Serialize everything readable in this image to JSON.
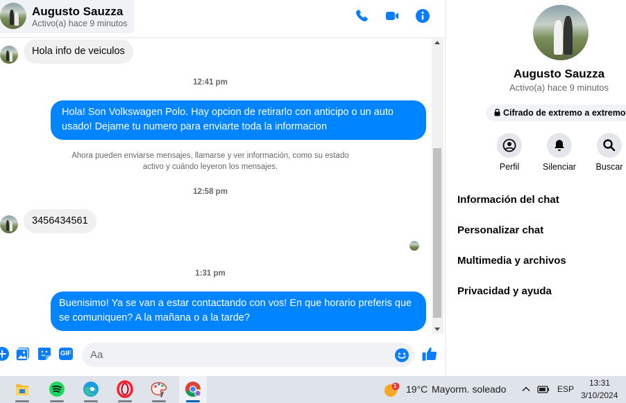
{
  "contact": {
    "name": "Augusto Sauzza",
    "status": "Activo(a) hace 9 minutos"
  },
  "header": {
    "icons": [
      "phone-icon",
      "video-call-icon",
      "info-icon"
    ]
  },
  "messages": [
    {
      "type": "incoming",
      "text": "Hola info de veiculos"
    },
    {
      "type": "time",
      "text": "12:41 pm"
    },
    {
      "type": "outgoing",
      "lines": [
        "Hola! Son Volkswagen Polo. Hay opcion de retirarlo con anticipo o un auto",
        "usado! Dejame tu numero para enviarte toda la informacion"
      ]
    },
    {
      "type": "system",
      "lines": [
        "Ahora pueden enviarse mensajes, llamarse y ver información, como su estado",
        "activo y cuándo leyeron los mensajes."
      ]
    },
    {
      "type": "time",
      "text": "12:58 pm"
    },
    {
      "type": "incoming",
      "text": "3456434561"
    },
    {
      "type": "time",
      "text": "1:31 pm"
    },
    {
      "type": "outgoing",
      "lines": [
        "Buenisimo! Ya se van a estar contactando con vos! En que horario preferis que",
        "se comuniquen? A la mañana o a la tarde?"
      ]
    }
  ],
  "composer": {
    "placeholder": "Aa",
    "value": "",
    "gif_label": "GIF",
    "icons": [
      "plus-icon",
      "image-icon",
      "sticker-icon",
      "gif-icon",
      "emoji-icon",
      "thumbs-up-icon"
    ]
  },
  "panel": {
    "name": "Augusto Sauzza",
    "status": "Activo(a) hace 9 minutos",
    "encryption": "Cifrado de extremo a extremo",
    "actions": [
      {
        "label": "Perfil",
        "icon": "profile-icon"
      },
      {
        "label": "Silenciar",
        "icon": "bell-icon"
      },
      {
        "label": "Buscar",
        "icon": "search-icon"
      }
    ],
    "items": [
      "Información del chat",
      "Personalizar chat",
      "Multimedia y archivos",
      "Privacidad y ayuda"
    ]
  },
  "taskbar": {
    "apps": [
      "file-explorer-icon",
      "spotify-icon",
      "edge-icon",
      "opera-icon",
      "paint-icon",
      "chrome-icon"
    ],
    "active_app": "chrome-icon",
    "weather": {
      "temp": "19°C",
      "desc": "Mayorm. soleado",
      "badge": "1"
    },
    "lang": "ESP",
    "time": "13:31",
    "date": "3/10/2024"
  },
  "colors": {
    "accent": "#0084ff",
    "bubble_in": "#f0f0f0",
    "taskbar": "#dfe3ea"
  }
}
